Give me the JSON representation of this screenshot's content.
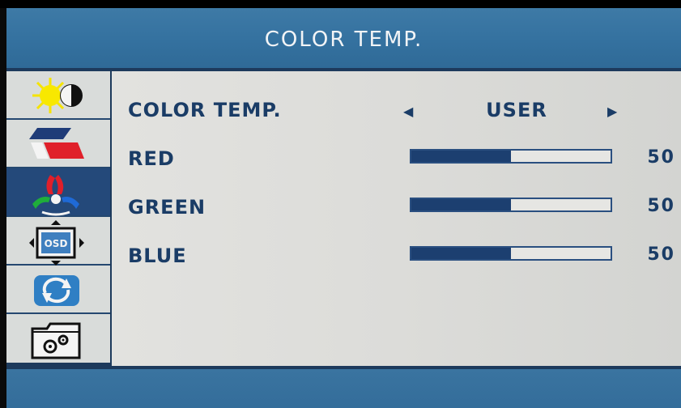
{
  "header": {
    "title": "COLOR TEMP."
  },
  "sidebar": {
    "items": [
      {
        "icon": "brightness-contrast-icon"
      },
      {
        "icon": "image-settings-icon"
      },
      {
        "icon": "color-temp-icon",
        "active": true
      },
      {
        "icon": "osd-position-icon"
      },
      {
        "icon": "reset-icon"
      },
      {
        "icon": "settings-folder-icon"
      }
    ]
  },
  "rows": {
    "color_temp": {
      "label": "COLOR TEMP.",
      "value": "USER"
    },
    "red": {
      "label": "RED",
      "value": "50",
      "level": 0.5
    },
    "green": {
      "label": "GREEN",
      "value": "50",
      "level": 0.5
    },
    "blue": {
      "label": "BLUE",
      "value": "50",
      "level": 0.5
    }
  },
  "colors": {
    "osd_blue": "#2f6890",
    "text": "#1a3c66",
    "panel": "#dcdcd9",
    "bar_fill": "#1c3f70"
  }
}
